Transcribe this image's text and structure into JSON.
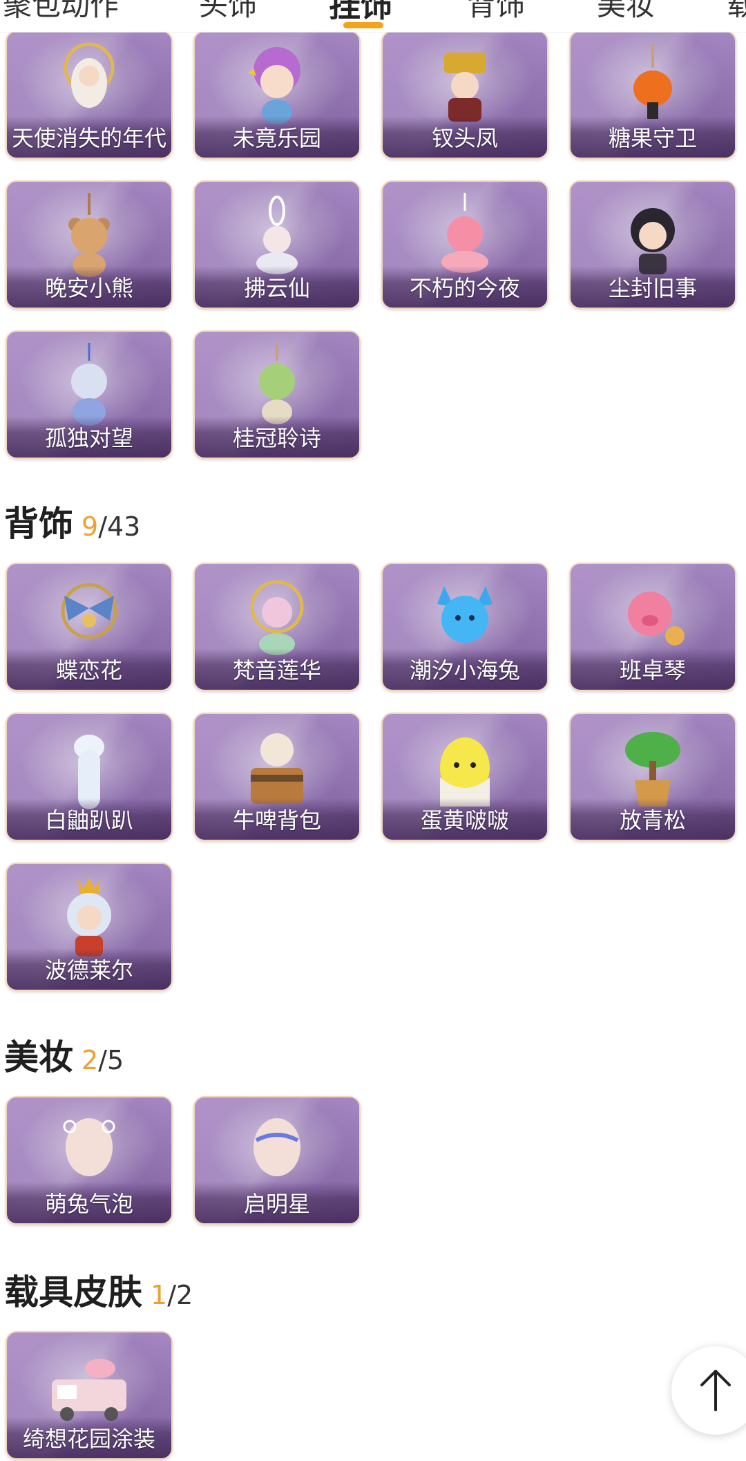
{
  "tabs": [
    {
      "label": "聚包动作"
    },
    {
      "label": "头饰"
    },
    {
      "label": "挂饰",
      "active": true
    },
    {
      "label": "背饰"
    },
    {
      "label": "美妆"
    },
    {
      "label": "载"
    }
  ],
  "pendants": {
    "items": [
      {
        "name": "天使消失的年代",
        "icon": "angel-charm-icon"
      },
      {
        "name": "未竟乐园",
        "icon": "clown-girl-charm-icon"
      },
      {
        "name": "钗头凤",
        "icon": "phoenix-crown-charm-icon"
      },
      {
        "name": "糖果守卫",
        "icon": "pumpkin-candy-charm-icon"
      },
      {
        "name": "晚安小熊",
        "icon": "bear-charm-icon"
      },
      {
        "name": "拂云仙",
        "icon": "cloud-fairy-charm-icon"
      },
      {
        "name": "不朽的今夜",
        "icon": "pink-fox-charm-icon"
      },
      {
        "name": "尘封旧事",
        "icon": "dark-hair-boy-charm-icon"
      },
      {
        "name": "孤独对望",
        "icon": "silver-fairy-charm-icon"
      },
      {
        "name": "桂冠聆诗",
        "icon": "green-fairy-charm-icon"
      }
    ]
  },
  "back_accessories": {
    "title": "背饰",
    "owned": "9",
    "total": "/43",
    "items": [
      {
        "name": "蝶恋花",
        "icon": "butterfly-mirror-icon"
      },
      {
        "name": "梵音莲华",
        "icon": "lotus-doll-icon"
      },
      {
        "name": "潮汐小海兔",
        "icon": "blue-bunny-icon"
      },
      {
        "name": "班卓琴",
        "icon": "pink-banjo-pig-icon"
      },
      {
        "name": "白鼬趴趴",
        "icon": "white-ferret-icon"
      },
      {
        "name": "牛啤背包",
        "icon": "cow-beer-backpack-icon"
      },
      {
        "name": "蛋黄啵啵",
        "icon": "egg-chick-icon"
      },
      {
        "name": "放青松",
        "icon": "bonsai-pine-icon"
      },
      {
        "name": "波德莱尔",
        "icon": "sheep-king-icon"
      }
    ]
  },
  "makeup": {
    "title": "美妆",
    "owned": "2",
    "total": "/5",
    "items": [
      {
        "name": "萌兔气泡",
        "icon": "bunny-bubble-makeup-icon"
      },
      {
        "name": "启明星",
        "icon": "star-makeup-icon"
      }
    ]
  },
  "vehicle_skins": {
    "title": "载具皮肤",
    "owned": "1",
    "total": "/2",
    "items": [
      {
        "name": "绮想花园涂装",
        "icon": "garden-truck-icon"
      }
    ]
  },
  "scroll_top": {
    "icon": "arrow-up-icon"
  },
  "colors": {
    "accent": "#f5a31a",
    "owned_count": "#f0a030",
    "card_purple": "#a486c2",
    "card_border": "#f0d7b9"
  }
}
